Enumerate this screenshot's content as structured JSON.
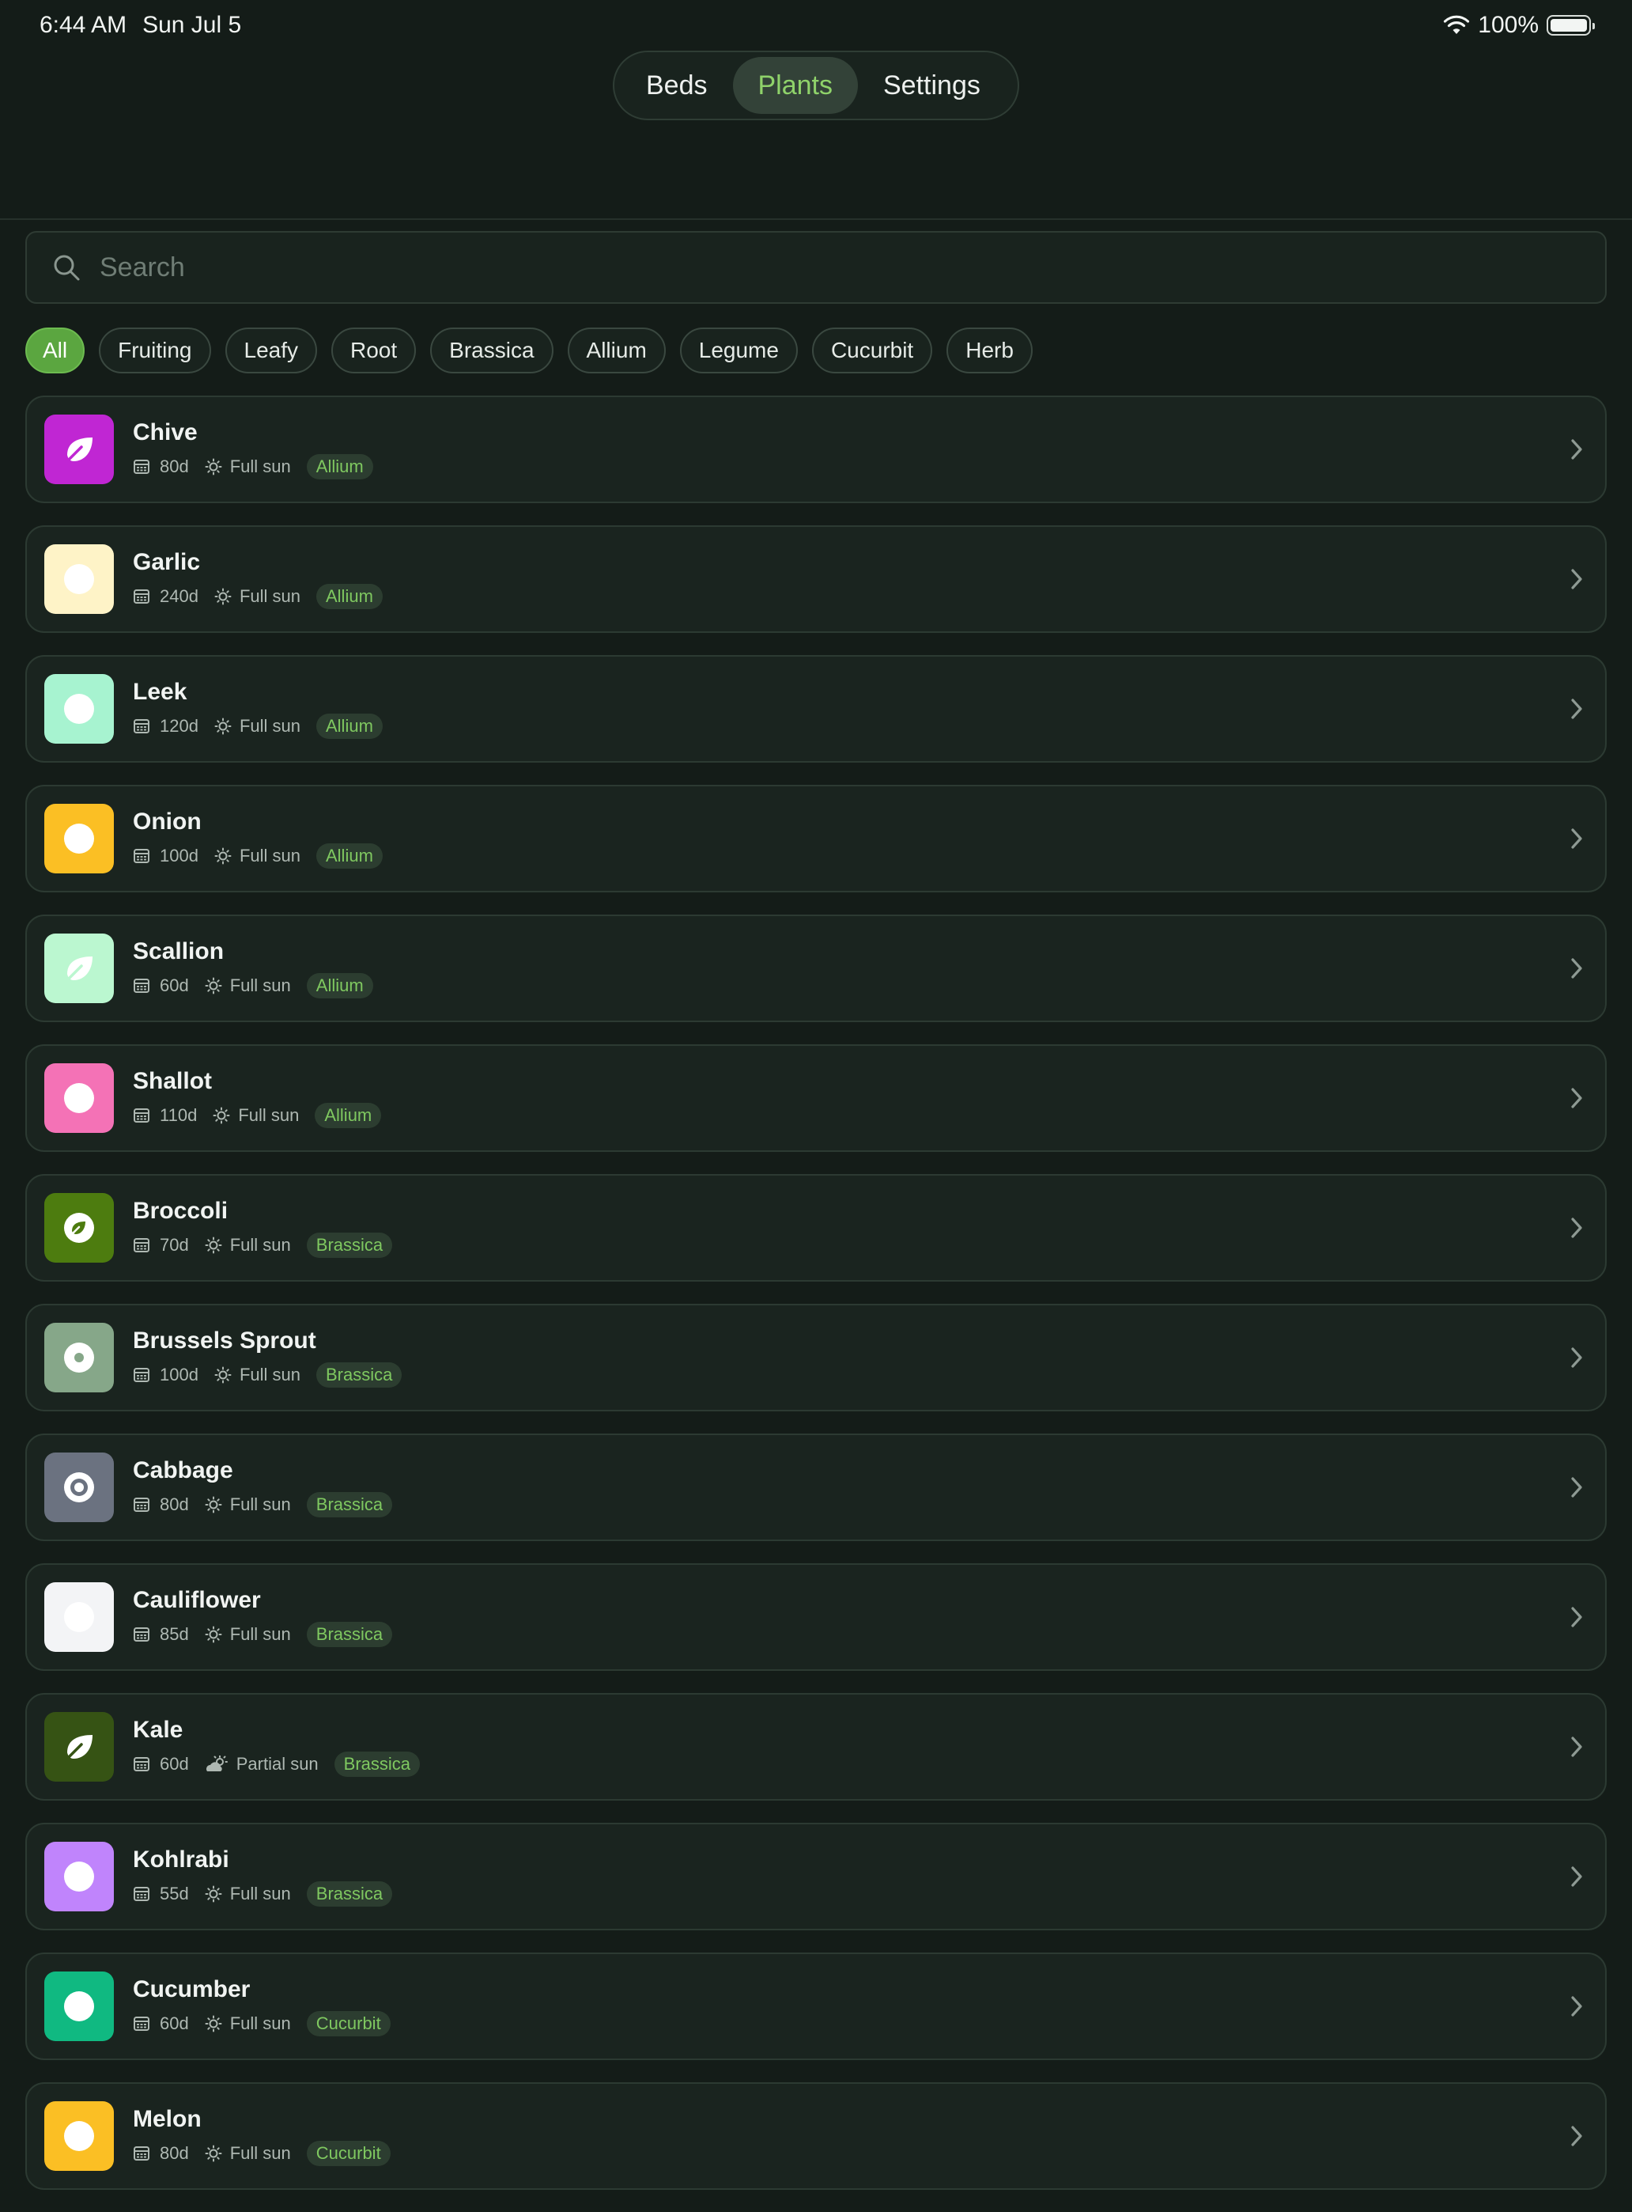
{
  "status": {
    "time": "6:44 AM",
    "date": "Sun Jul 5",
    "battery": "100%"
  },
  "tabs": [
    {
      "label": "Beds",
      "active": false
    },
    {
      "label": "Plants",
      "active": true
    },
    {
      "label": "Settings",
      "active": false
    }
  ],
  "search": {
    "placeholder": "Search",
    "value": ""
  },
  "filters": [
    {
      "label": "All",
      "active": true
    },
    {
      "label": "Fruiting",
      "active": false
    },
    {
      "label": "Leafy",
      "active": false
    },
    {
      "label": "Root",
      "active": false
    },
    {
      "label": "Brassica",
      "active": false
    },
    {
      "label": "Allium",
      "active": false
    },
    {
      "label": "Legume",
      "active": false
    },
    {
      "label": "Cucurbit",
      "active": false
    },
    {
      "label": "Herb",
      "active": false
    }
  ],
  "plants": [
    {
      "name": "Chive",
      "days": "80d",
      "sun": "Full sun",
      "sun_icon": "sun-icon",
      "family": "Allium",
      "color": "#c026d3",
      "icon": "leaf-icon"
    },
    {
      "name": "Garlic",
      "days": "240d",
      "sun": "Full sun",
      "sun_icon": "sun-icon",
      "family": "Allium",
      "color": "#fef3c7",
      "icon": "circle-icon"
    },
    {
      "name": "Leek",
      "days": "120d",
      "sun": "Full sun",
      "sun_icon": "sun-icon",
      "family": "Allium",
      "color": "#a7f3d0",
      "icon": "circle-icon"
    },
    {
      "name": "Onion",
      "days": "100d",
      "sun": "Full sun",
      "sun_icon": "sun-icon",
      "family": "Allium",
      "color": "#fbbf24",
      "icon": "circle-icon"
    },
    {
      "name": "Scallion",
      "days": "60d",
      "sun": "Full sun",
      "sun_icon": "sun-icon",
      "family": "Allium",
      "color": "#bbf7d0",
      "icon": "leaf-icon"
    },
    {
      "name": "Shallot",
      "days": "110d",
      "sun": "Full sun",
      "sun_icon": "sun-icon",
      "family": "Allium",
      "color": "#f472b6",
      "icon": "circle-icon"
    },
    {
      "name": "Broccoli",
      "days": "70d",
      "sun": "Full sun",
      "sun_icon": "sun-icon",
      "family": "Brassica",
      "color": "#4d7c0f",
      "icon": "leaf-circle-icon"
    },
    {
      "name": "Brussels Sprout",
      "days": "100d",
      "sun": "Full sun",
      "sun_icon": "sun-icon",
      "family": "Brassica",
      "color": "#86a789",
      "icon": "dot-circle-icon"
    },
    {
      "name": "Cabbage",
      "days": "80d",
      "sun": "Full sun",
      "sun_icon": "sun-icon",
      "family": "Brassica",
      "color": "#6b7280",
      "icon": "ring-icon"
    },
    {
      "name": "Cauliflower",
      "days": "85d",
      "sun": "Full sun",
      "sun_icon": "sun-icon",
      "family": "Brassica",
      "color": "#f3f4f6",
      "icon": "circle-icon"
    },
    {
      "name": "Kale",
      "days": "60d",
      "sun": "Partial sun",
      "sun_icon": "partial-sun-icon",
      "family": "Brassica",
      "color": "#365314",
      "icon": "leaf-icon"
    },
    {
      "name": "Kohlrabi",
      "days": "55d",
      "sun": "Full sun",
      "sun_icon": "sun-icon",
      "family": "Brassica",
      "color": "#c084fc",
      "icon": "circle-icon"
    },
    {
      "name": "Cucumber",
      "days": "60d",
      "sun": "Full sun",
      "sun_icon": "sun-icon",
      "family": "Cucurbit",
      "color": "#10b981",
      "icon": "circle-icon"
    },
    {
      "name": "Melon",
      "days": "80d",
      "sun": "Full sun",
      "sun_icon": "sun-icon",
      "family": "Cucurbit",
      "color": "#fbbf24",
      "icon": "circle-icon"
    }
  ]
}
